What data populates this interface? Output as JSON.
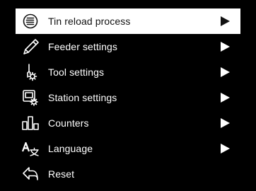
{
  "menu": {
    "items": [
      {
        "label": "Tin reload process",
        "icon": "tin-reload-icon",
        "selected": true,
        "has_submenu": true
      },
      {
        "label": "Feeder settings",
        "icon": "feeder-icon",
        "selected": false,
        "has_submenu": true
      },
      {
        "label": "Tool settings",
        "icon": "tool-settings-icon",
        "selected": false,
        "has_submenu": true
      },
      {
        "label": "Station settings",
        "icon": "station-settings-icon",
        "selected": false,
        "has_submenu": true
      },
      {
        "label": "Counters",
        "icon": "counters-icon",
        "selected": false,
        "has_submenu": true
      },
      {
        "label": "Language",
        "icon": "language-icon",
        "selected": false,
        "has_submenu": true
      },
      {
        "label": "Reset",
        "icon": "reset-icon",
        "selected": false,
        "has_submenu": false
      }
    ]
  },
  "colors": {
    "background": "#000000",
    "text": "#ffffff",
    "selected_background": "#ffffff",
    "selected_text": "#111111"
  }
}
